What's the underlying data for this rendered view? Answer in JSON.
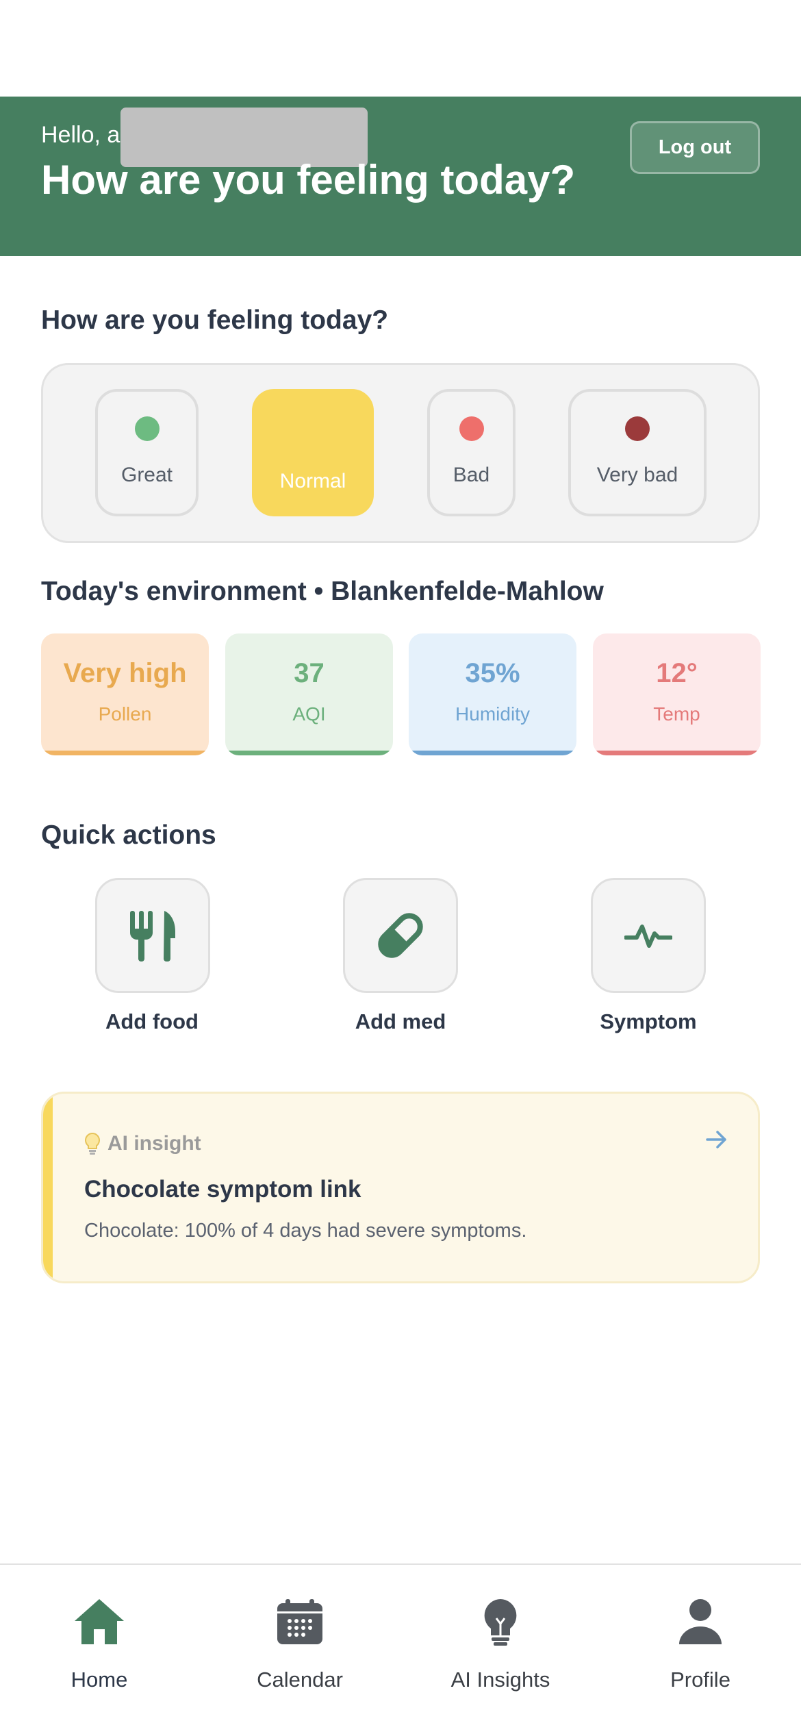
{
  "header": {
    "greeting": "Hello, a",
    "title": "How are you feeling today?",
    "logout_label": "Log out",
    "bg_color": "#467f60"
  },
  "mood": {
    "section_title": "How are you feeling today?",
    "options": [
      {
        "label": "Great",
        "color": "#6dbb81",
        "selected": false
      },
      {
        "label": "Normal",
        "color": "#f8d85c",
        "selected": true
      },
      {
        "label": "Bad",
        "color": "#ee6f6b",
        "selected": false
      },
      {
        "label": "Very bad",
        "color": "#9b3a3b",
        "selected": false
      }
    ]
  },
  "environment": {
    "section_title": "Today's environment • Blankenfelde-Mahlow",
    "cards": [
      {
        "value": "Very high",
        "label": "Pollen",
        "bg": "#fde5cf",
        "fg": "#e8a94f",
        "bar": "#f1b463"
      },
      {
        "value": "37",
        "label": "AQI",
        "bg": "#e8f3e8",
        "fg": "#6cb07c",
        "bar": "#6cb07c"
      },
      {
        "value": "35%",
        "label": "Humidity",
        "bg": "#e5f1fb",
        "fg": "#6fa4d2",
        "bar": "#6fa4d2"
      },
      {
        "value": "12°",
        "label": "Temp",
        "bg": "#fde9ea",
        "fg": "#e47a7a",
        "bar": "#e47a7a"
      }
    ]
  },
  "quick_actions": {
    "section_title": "Quick actions",
    "items": [
      {
        "label": "Add food",
        "icon": "fork-knife-icon"
      },
      {
        "label": "Add med",
        "icon": "pill-icon"
      },
      {
        "label": "Symptom",
        "icon": "pulse-icon"
      }
    ]
  },
  "insight": {
    "tag": "AI insight",
    "title": "Chocolate symptom link",
    "body": "Chocolate: 100% of 4 days had severe symptoms."
  },
  "tabbar": {
    "tabs": [
      {
        "label": "Home",
        "icon": "home-icon",
        "active": true
      },
      {
        "label": "Calendar",
        "icon": "calendar-icon",
        "active": false
      },
      {
        "label": "AI Insights",
        "icon": "lightbulb-icon",
        "active": false
      },
      {
        "label": "Profile",
        "icon": "person-icon",
        "active": false
      }
    ]
  },
  "colors": {
    "accent": "#467f60",
    "text": "#2d3748",
    "selected_mood": "#f8d85c"
  }
}
